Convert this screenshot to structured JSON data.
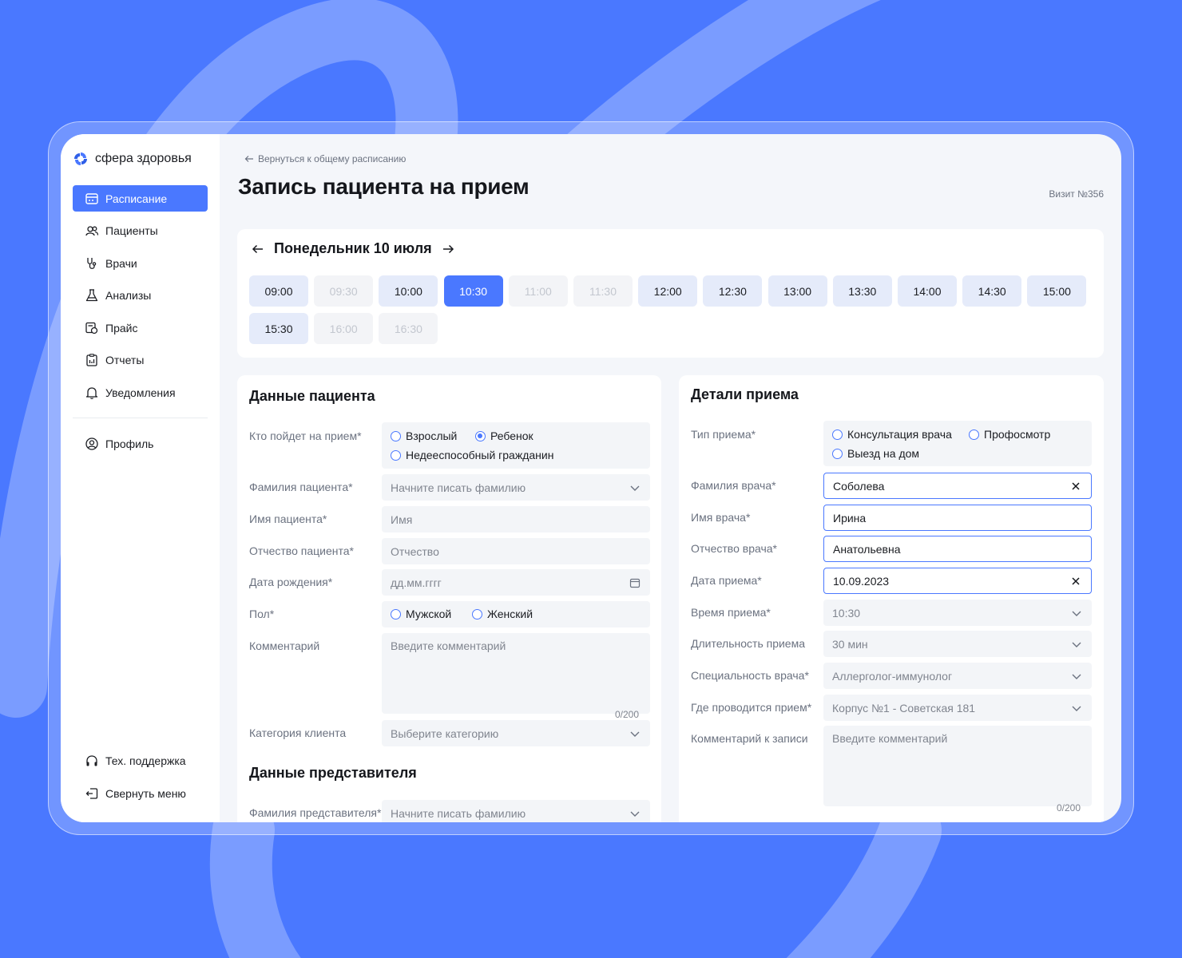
{
  "brand": {
    "name": "сфера здоровья",
    "accent": "#4a78ff"
  },
  "sidebar": {
    "items": [
      {
        "label": "Расписание",
        "icon": "calendar-icon",
        "active": true
      },
      {
        "label": "Пациенты",
        "icon": "users-icon"
      },
      {
        "label": "Врачи",
        "icon": "stethoscope-icon"
      },
      {
        "label": "Анализы",
        "icon": "flask-icon"
      },
      {
        "label": "Прайс",
        "icon": "price-icon"
      },
      {
        "label": "Отчеты",
        "icon": "report-icon"
      },
      {
        "label": "Уведомления",
        "icon": "bell-icon"
      }
    ],
    "profile": {
      "label": "Профиль",
      "icon": "user-circle-icon"
    },
    "support": {
      "label": "Тех. поддержка",
      "icon": "headphones-icon"
    },
    "collapse": {
      "label": "Свернуть меню",
      "icon": "logout-icon"
    }
  },
  "header": {
    "back_label": "Вернуться к общему расписанию",
    "title": "Запись пациента на прием",
    "visit": "Визит №356"
  },
  "schedule": {
    "day_label": "Понедельник 10 июля",
    "slots": [
      {
        "time": "09:00",
        "state": "available"
      },
      {
        "time": "09:30",
        "state": "disabled"
      },
      {
        "time": "10:00",
        "state": "available"
      },
      {
        "time": "10:30",
        "state": "selected"
      },
      {
        "time": "11:00",
        "state": "disabled"
      },
      {
        "time": "11:30",
        "state": "disabled"
      },
      {
        "time": "12:00",
        "state": "available"
      },
      {
        "time": "12:30",
        "state": "available"
      },
      {
        "time": "13:00",
        "state": "available"
      },
      {
        "time": "13:30",
        "state": "available"
      },
      {
        "time": "14:00",
        "state": "available"
      },
      {
        "time": "14:30",
        "state": "available"
      },
      {
        "time": "15:00",
        "state": "available"
      },
      {
        "time": "15:30",
        "state": "available"
      },
      {
        "time": "16:00",
        "state": "disabled"
      },
      {
        "time": "16:30",
        "state": "disabled"
      }
    ]
  },
  "patient": {
    "title": "Данные пациента",
    "who_label": "Кто пойдет на прием*",
    "who_options": [
      "Взрослый",
      "Ребенок",
      "Недееспособный гражданин"
    ],
    "who_selected": "Ребенок",
    "surname_label": "Фамилия пациента*",
    "surname_placeholder": "Начните писать фамилию",
    "name_label": "Имя пациента*",
    "name_placeholder": "Имя",
    "patronymic_label": "Отчество пациента*",
    "patronymic_placeholder": "Отчество",
    "birth_label": "Дата рождения*",
    "birth_placeholder": "дд.мм.гггг",
    "gender_label": "Пол*",
    "gender_options": [
      "Мужской",
      "Женский"
    ],
    "comment_label": "Комментарий",
    "comment_placeholder": "Введите комментарий",
    "comment_counter": "0/200",
    "category_label": "Категория клиента",
    "category_placeholder": "Выберите категорию"
  },
  "representative": {
    "title": "Данные представителя",
    "surname_label": "Фамилия представителя*",
    "surname_placeholder": "Начните писать фамилию"
  },
  "appointment": {
    "title": "Детали приема",
    "type_label": "Тип приема*",
    "type_options": [
      "Консультация врача",
      "Профосмотр",
      "Выезд на дом"
    ],
    "doctor_surname_label": "Фамилия врача*",
    "doctor_surname": "Соболева",
    "doctor_name_label": "Имя врача*",
    "doctor_name": "Ирина",
    "doctor_patronymic_label": "Отчество врача*",
    "doctor_patronymic": "Анатольевна",
    "date_label": "Дата приема*",
    "date": "10.09.2023",
    "time_label": "Время приема*",
    "time": "10:30",
    "duration_label": "Длительность приема",
    "duration": "30 мин",
    "specialty_label": "Специальность врача*",
    "specialty": "Аллерголог-иммунолог",
    "location_label": "Где проводится прием*",
    "location": "Корпус №1 - Советская 181",
    "comment_label": "Комментарий к записи",
    "comment_placeholder": "Введите комментарий",
    "comment_counter": "0/200"
  }
}
